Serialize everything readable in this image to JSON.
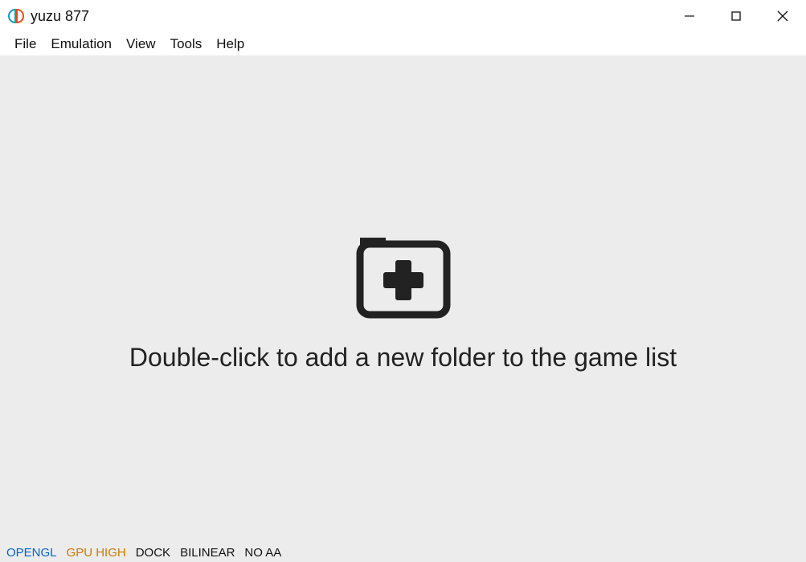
{
  "titlebar": {
    "title": "yuzu 877"
  },
  "menubar": {
    "items": [
      "File",
      "Emulation",
      "View",
      "Tools",
      "Help"
    ]
  },
  "main": {
    "prompt": "Double-click to add a new folder to the game list"
  },
  "statusbar": {
    "renderer": "OPENGL",
    "gpu": "GPU HIGH",
    "dock": "DOCK",
    "filter": "BILINEAR",
    "aa": "NO AA"
  }
}
